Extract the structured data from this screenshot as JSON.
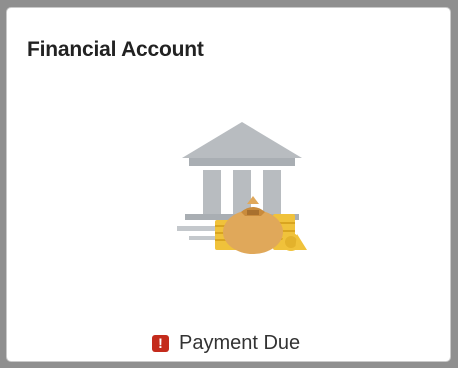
{
  "tile": {
    "title": "Financial Account",
    "icon": "bank-money-bag-icon",
    "status": {
      "icon": "alert-icon",
      "icon_glyph": "!",
      "text": "Payment Due",
      "color": "#c42b1c"
    }
  },
  "colors": {
    "background": "#8f8f8f",
    "building": "#b8bcc0",
    "coins": "#f0c23b",
    "bag": "#e0a85a"
  }
}
